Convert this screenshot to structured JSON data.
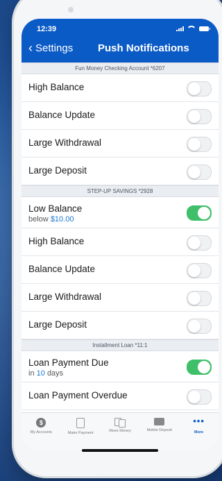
{
  "status": {
    "time": "12:39"
  },
  "nav": {
    "back_label": "Settings",
    "title": "Push Notifications"
  },
  "sections": [
    {
      "header": "Fun Money Checking Account *6207",
      "items": [
        {
          "label": "High Balance",
          "on": false
        },
        {
          "label": "Balance Update",
          "on": false
        },
        {
          "label": "Large Withdrawal",
          "on": false
        },
        {
          "label": "Large Deposit",
          "on": false
        }
      ]
    },
    {
      "header": "STEP-UP SAVINGS *2928",
      "items": [
        {
          "label": "Low Balance",
          "sub_prefix": "below",
          "sub_value": "$10.00",
          "sub_suffix": "",
          "on": true
        },
        {
          "label": "High Balance",
          "on": false
        },
        {
          "label": "Balance Update",
          "on": false
        },
        {
          "label": "Large Withdrawal",
          "on": false
        },
        {
          "label": "Large Deposit",
          "on": false
        }
      ]
    },
    {
      "header": "Installment Loan *11:1",
      "items": [
        {
          "label": "Loan Payment Due",
          "sub_prefix": "in",
          "sub_value": "10",
          "sub_suffix": "days",
          "on": true
        },
        {
          "label": "Loan Payment Overdue",
          "on": false
        }
      ]
    }
  ],
  "tabs": [
    {
      "label": "My Accounts",
      "icon": "dollar-icon",
      "active": false
    },
    {
      "label": "Make Payment",
      "icon": "document-icon",
      "active": false
    },
    {
      "label": "Move Money",
      "icon": "transfer-icon",
      "active": false
    },
    {
      "label": "Mobile Deposit",
      "icon": "check-deposit-icon",
      "active": false
    },
    {
      "label": "More",
      "icon": "more-icon",
      "active": true
    }
  ],
  "colors": {
    "brand_blue": "#0b5bc7",
    "toggle_on": "#3fbf6a",
    "accent_text": "#1976d2"
  }
}
